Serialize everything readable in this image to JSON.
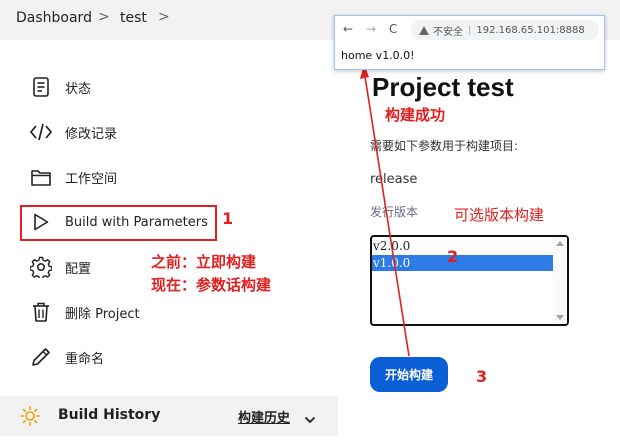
{
  "breadcrumb": {
    "items": [
      "Dashboard",
      "test"
    ],
    "separator": ">"
  },
  "sidebar": {
    "items": [
      {
        "label": "状态",
        "icon": "document-icon"
      },
      {
        "label": "修改记录",
        "icon": "code-icon"
      },
      {
        "label": "工作空间",
        "icon": "folder-icon"
      },
      {
        "label": "Build with Parameters",
        "icon": "play-icon"
      },
      {
        "label": "配置",
        "icon": "gear-icon"
      },
      {
        "label": "删除 Project",
        "icon": "trash-icon"
      },
      {
        "label": "重命名",
        "icon": "pencil-icon"
      }
    ]
  },
  "build_history": {
    "title": "Build History",
    "link": "构建历史",
    "icon": "sun-icon"
  },
  "main": {
    "title": "Project test",
    "description": "需要如下参数用于构建项目:",
    "param_name": "release",
    "param_desc": "发行版本",
    "options": [
      "v2.0.0",
      "v1.0.0"
    ],
    "selected_option": "v1.0.0",
    "build_button": "开始构建"
  },
  "annotations": {
    "success": "构建成功",
    "optional": "可选版本构建",
    "before": "之前：立即构建",
    "now": "现在：参数话构建",
    "n1": "1",
    "n2": "2",
    "n3": "3"
  },
  "popup": {
    "back": "←",
    "forward": "→",
    "reload": "C",
    "warning": "不安全",
    "url": "192.168.65.101:8888",
    "content": "home v1.0.0!"
  },
  "colors": {
    "annotation": "#e02020",
    "button": "#0b5fd6",
    "selected": "#2f7be6"
  }
}
